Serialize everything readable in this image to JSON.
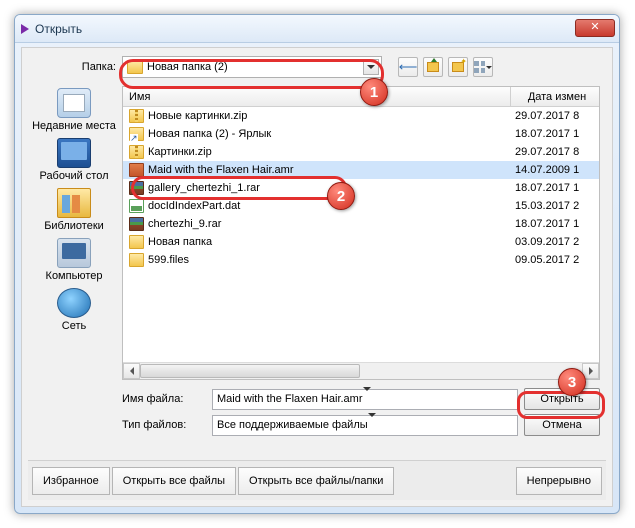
{
  "window": {
    "title": "Открыть"
  },
  "folder_row": {
    "label": "Папка:",
    "current": "Новая папка (2)"
  },
  "headers": {
    "name": "Имя",
    "date": "Дата измен"
  },
  "files": [
    {
      "icon": "zip",
      "name": "Новые картинки.zip",
      "date": "29.07.2017 8"
    },
    {
      "icon": "lnk",
      "name": "Новая папка (2) - Ярлык",
      "date": "18.07.2017 1"
    },
    {
      "icon": "zip",
      "name": "Картинки.zip",
      "date": "29.07.2017 8"
    },
    {
      "icon": "amr",
      "name": "Maid with the Flaxen Hair.amr",
      "date": "14.07.2009 1",
      "selected": true
    },
    {
      "icon": "rar",
      "name": "gallery_chertezhi_1.rar",
      "date": "18.07.2017 1"
    },
    {
      "icon": "dat",
      "name": "docIdIndexPart.dat",
      "date": "15.03.2017 2"
    },
    {
      "icon": "rar",
      "name": "chertezhi_9.rar",
      "date": "18.07.2017 1"
    },
    {
      "icon": "fold",
      "name": "Новая папка",
      "date": "03.09.2017 2"
    },
    {
      "icon": "fold",
      "name": "599.files",
      "date": "09.05.2017 2"
    }
  ],
  "places": [
    {
      "label": "Недавние места",
      "name": "place-recent",
      "icon": "ico-recent"
    },
    {
      "label": "Рабочий стол",
      "name": "place-desktop",
      "icon": "ico-desktop"
    },
    {
      "label": "Библиотеки",
      "name": "place-libraries",
      "icon": "ico-lib"
    },
    {
      "label": "Компьютер",
      "name": "place-computer",
      "icon": "ico-pc"
    },
    {
      "label": "Сеть",
      "name": "place-network",
      "icon": "ico-net"
    }
  ],
  "fields": {
    "filename_label": "Имя файла:",
    "filename_value": "Maid with the Flaxen Hair.amr",
    "filetype_label": "Тип файлов:",
    "filetype_value": "Все поддерживаемые файлы"
  },
  "buttons": {
    "open": "Открыть",
    "cancel": "Отмена"
  },
  "footer": {
    "fav": "Избранное",
    "open_all": "Открыть все файлы",
    "open_all_folders": "Открыть все файлы/папки",
    "continuous": "Непрерывно"
  },
  "callouts": {
    "b1": "1",
    "b2": "2",
    "b3": "3"
  }
}
